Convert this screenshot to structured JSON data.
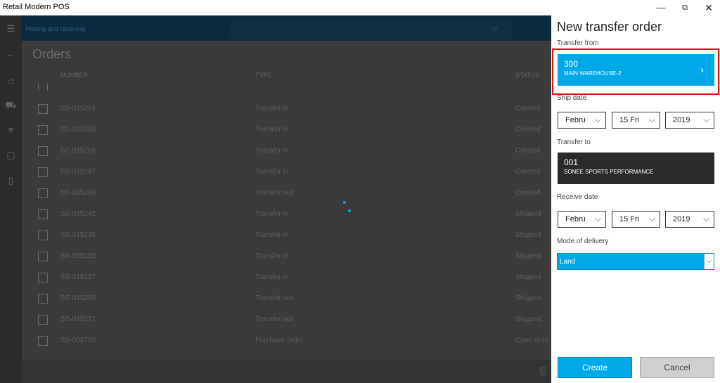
{
  "app": {
    "title": "Retail Modern POS"
  },
  "window_controls": {
    "minimize": "—",
    "restore": "⧉",
    "close": "✕"
  },
  "topbar": {
    "breadcrumb": "Picking and receiving"
  },
  "orders": {
    "title": "Orders",
    "columns": {
      "number": "NUMBER",
      "type": "TYPE",
      "status": "STATUS"
    },
    "rows": [
      {
        "number": "SS-015263",
        "type": "Transfer in",
        "status": "Created"
      },
      {
        "number": "SS-015264",
        "type": "Transfer in",
        "status": "Created"
      },
      {
        "number": "SS-015265",
        "type": "Transfer in",
        "status": "Created"
      },
      {
        "number": "SS-015266",
        "type": "Transfer in",
        "status": "Created"
      },
      {
        "number": "SS-015267",
        "type": "Transfer in",
        "status": "Created"
      },
      {
        "number": "SS-015268",
        "type": "Transfer out",
        "status": "Created"
      },
      {
        "number": "SS-015242",
        "type": "Transfer in",
        "status": "Shipped"
      },
      {
        "number": "SS-015245",
        "type": "Transfer in",
        "status": "Shipped"
      },
      {
        "number": "SS-015252",
        "type": "Transfer in",
        "status": "Shipped"
      },
      {
        "number": "SS-015257",
        "type": "Transfer in",
        "status": "Shipped"
      },
      {
        "number": "SS-015269",
        "type": "Transfer out",
        "status": "Shipped"
      },
      {
        "number": "SS-015271",
        "type": "Transfer out",
        "status": "Shipped"
      },
      {
        "number": "SS-004763",
        "type": "Purchase order",
        "status": "Open orde"
      }
    ]
  },
  "panel": {
    "title": "New transfer order",
    "transfer_from": {
      "label": "Transfer from",
      "code": "300",
      "name": "MAIN WAREHOUSE-2",
      "chevron": "›"
    },
    "ship_date": {
      "label": "Ship date",
      "month": "Febru",
      "day": "15 Fri",
      "year": "2019"
    },
    "transfer_to": {
      "label": "Transfer to",
      "code": "001",
      "name": "SONEE SPORTS PERFORMANCE"
    },
    "receive_date": {
      "label": "Receive date",
      "month": "Febru",
      "day": "15 Fri",
      "year": "2019"
    },
    "mode_of_delivery": {
      "label": "Mode of delivery",
      "value": "Land"
    },
    "create_label": "Create",
    "cancel_label": "Cancel"
  },
  "icons": {
    "menu": "hamburger-icon",
    "back": "back-arrow-icon",
    "home": "home-icon",
    "products": "products-icon",
    "orders": "orders-icon",
    "bag": "shopping-bag-icon",
    "gift": "gift-card-icon",
    "search": "search-icon",
    "trash": "trash-icon",
    "chevron_down": "chevron-down-icon"
  },
  "colors": {
    "accent": "#00a8e8",
    "highlight": "#e01010",
    "dark_tile": "#2b2b2b"
  }
}
